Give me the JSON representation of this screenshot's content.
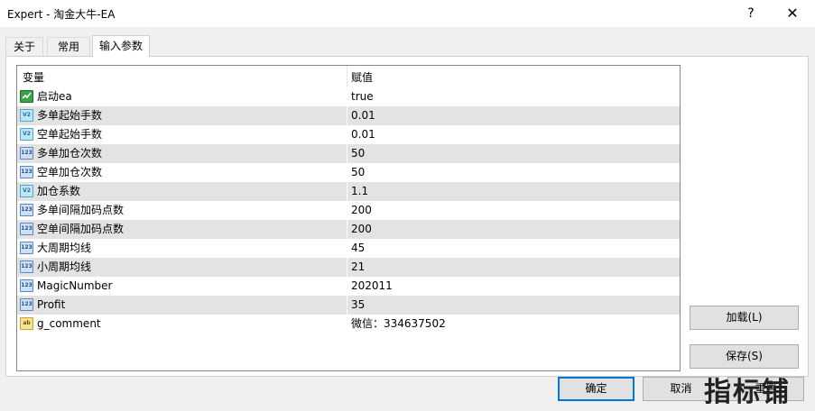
{
  "window": {
    "title": "Expert - 淘金大牛-EA",
    "help_label": "?",
    "close_label": "✕"
  },
  "tabs": [
    {
      "label": "关于"
    },
    {
      "label": "常用"
    },
    {
      "label": "输入参数"
    }
  ],
  "table": {
    "headers": {
      "variable": "变量",
      "value": "赋值"
    },
    "rows": [
      {
        "type": "bool",
        "icon_text": "",
        "name": "启动ea",
        "value": "true"
      },
      {
        "type": "double",
        "icon_text": "V2",
        "name": "多单起始手数",
        "value": "0.01"
      },
      {
        "type": "double",
        "icon_text": "V2",
        "name": "空单起始手数",
        "value": "0.01"
      },
      {
        "type": "int",
        "icon_text": "123",
        "name": "多单加仓次数",
        "value": "50"
      },
      {
        "type": "int",
        "icon_text": "123",
        "name": "空单加仓次数",
        "value": "50"
      },
      {
        "type": "double",
        "icon_text": "V2",
        "name": "加仓系数",
        "value": "1.1"
      },
      {
        "type": "int",
        "icon_text": "123",
        "name": "多单间隔加码点数",
        "value": "200"
      },
      {
        "type": "int",
        "icon_text": "123",
        "name": "空单间隔加码点数",
        "value": "200"
      },
      {
        "type": "int",
        "icon_text": "123",
        "name": "大周期均线",
        "value": "45"
      },
      {
        "type": "int",
        "icon_text": "123",
        "name": "小周期均线",
        "value": "21"
      },
      {
        "type": "int",
        "icon_text": "123",
        "name": "MagicNumber",
        "value": "202011"
      },
      {
        "type": "int",
        "icon_text": "123",
        "name": "Profit",
        "value": "35"
      },
      {
        "type": "string",
        "icon_text": "ab",
        "name": "g_comment",
        "value": "微信：334637502"
      }
    ]
  },
  "buttons": {
    "load": "加载(L)",
    "save": "保存(S)",
    "ok": "确定",
    "cancel": "取消",
    "reset": "重置"
  },
  "watermark": "指标铺"
}
